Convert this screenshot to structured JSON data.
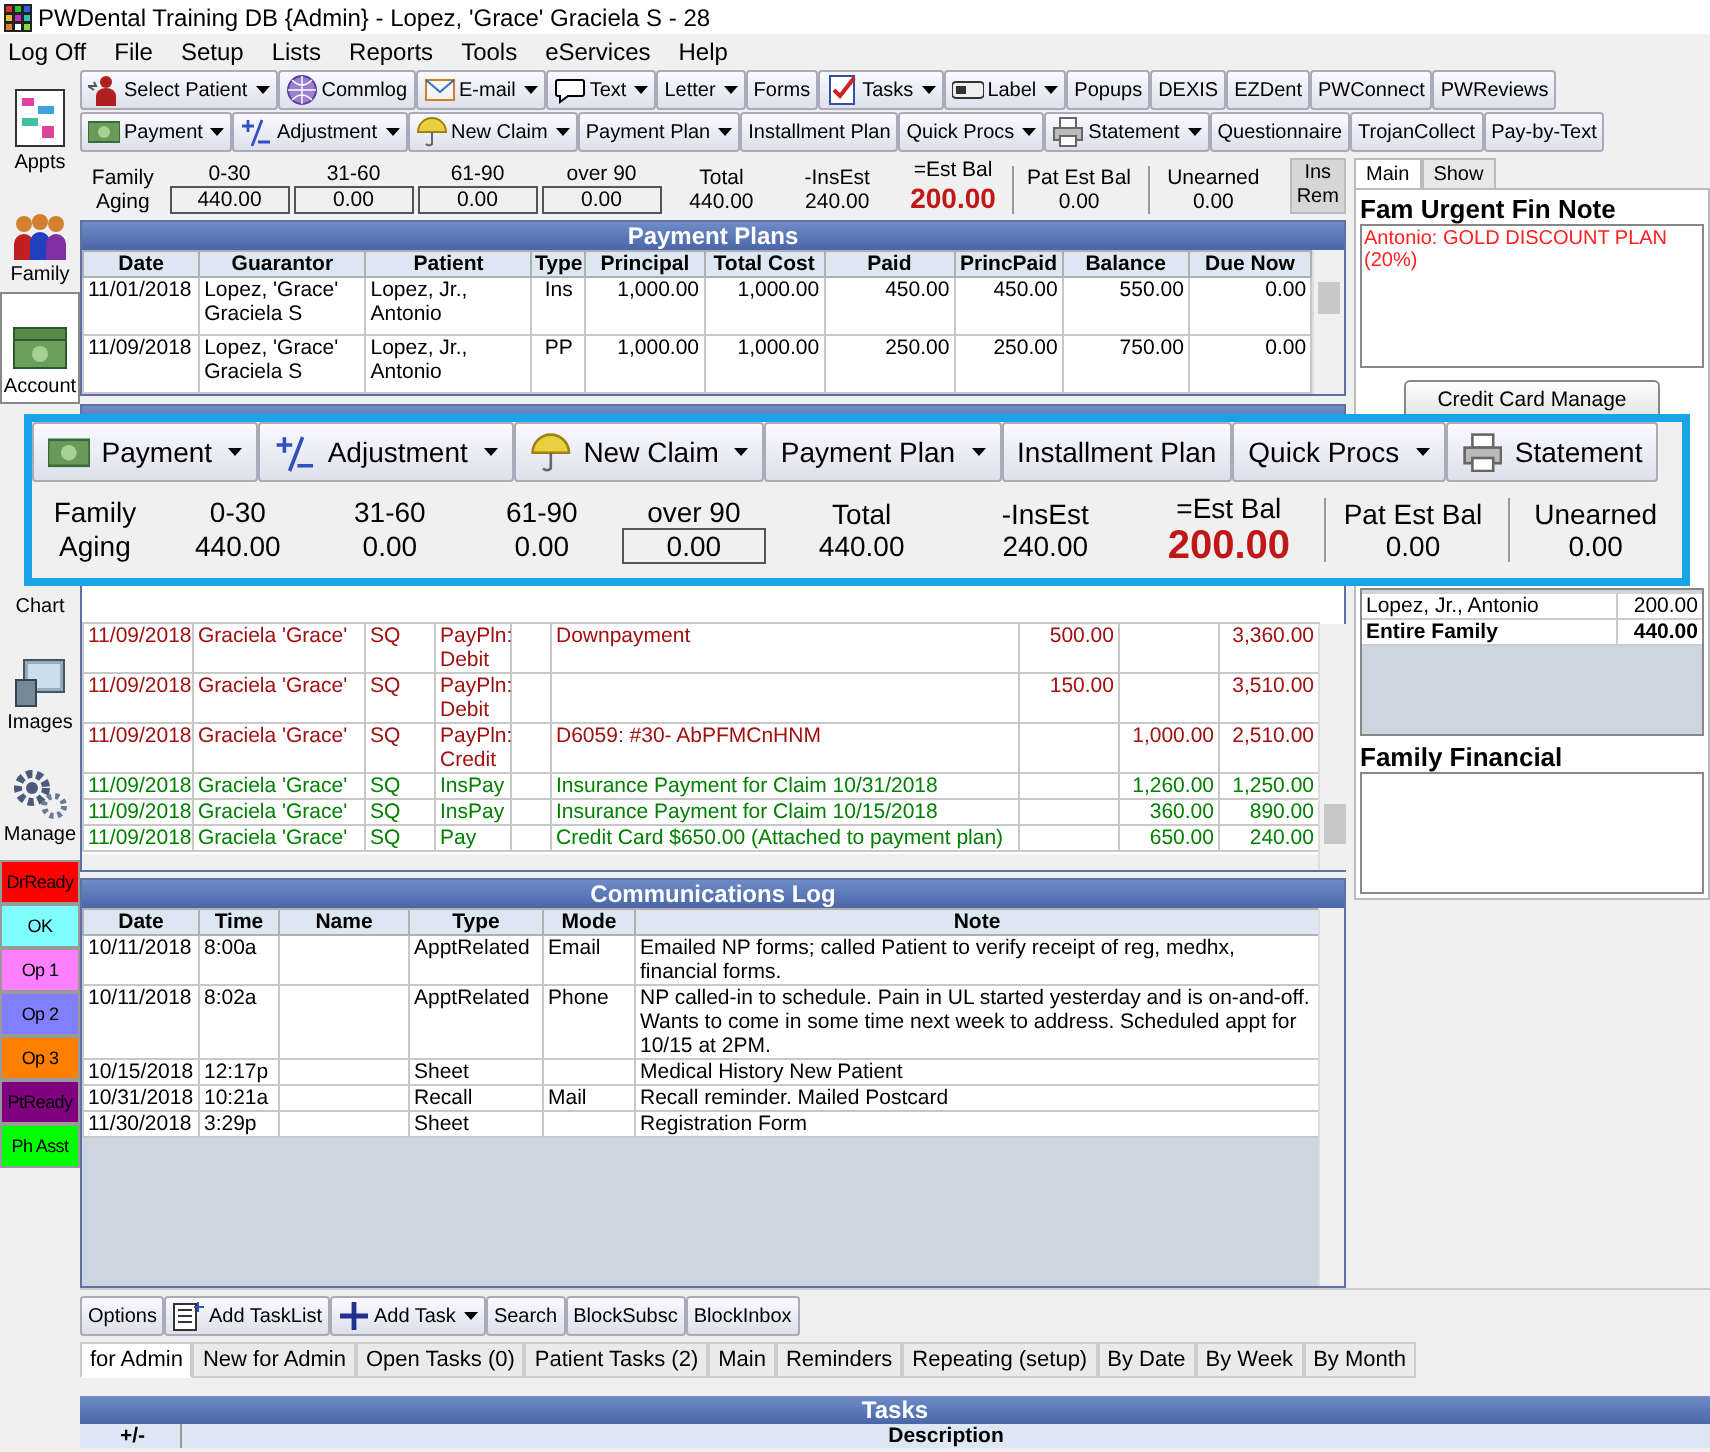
{
  "window": {
    "title": "PWDental Training DB {Admin} - Lopez, 'Grace' Graciela S - 28"
  },
  "menu": [
    "Log Off",
    "File",
    "Setup",
    "Lists",
    "Reports",
    "Tools",
    "eServices",
    "Help"
  ],
  "main_toolbar": [
    {
      "label": "Select Patient",
      "dropdown": true
    },
    {
      "label": "Commlog",
      "dropdown": false
    },
    {
      "label": "E-mail",
      "dropdown": true
    },
    {
      "label": "Text",
      "dropdown": true
    },
    {
      "label": "Letter",
      "dropdown": true
    },
    {
      "label": "Forms",
      "dropdown": false
    },
    {
      "label": "Tasks",
      "dropdown": true
    },
    {
      "label": "Label",
      "dropdown": true
    },
    {
      "label": "Popups",
      "dropdown": false
    },
    {
      "label": "DEXIS",
      "dropdown": false
    },
    {
      "label": "EZDent",
      "dropdown": false
    },
    {
      "label": "PWConnect",
      "dropdown": false
    },
    {
      "label": "PWReviews",
      "dropdown": false
    }
  ],
  "account_toolbar": [
    {
      "label": "Payment",
      "dropdown": true
    },
    {
      "label": "Adjustment",
      "dropdown": true
    },
    {
      "label": "New Claim",
      "dropdown": true
    },
    {
      "label": "Payment Plan",
      "dropdown": true
    },
    {
      "label": "Installment Plan",
      "dropdown": false
    },
    {
      "label": "Quick Procs",
      "dropdown": true
    },
    {
      "label": "Statement",
      "dropdown": true
    },
    {
      "label": "Questionnaire",
      "dropdown": false
    },
    {
      "label": "TrojanCollect",
      "dropdown": false
    },
    {
      "label": "Pay-by-Text",
      "dropdown": false
    }
  ],
  "aging": {
    "family_label": "Family Aging",
    "buckets": [
      {
        "label": "0-30",
        "value": "440.00",
        "boxed": true
      },
      {
        "label": "31-60",
        "value": "0.00",
        "boxed": true
      },
      {
        "label": "61-90",
        "value": "0.00",
        "boxed": true
      },
      {
        "label": "over 90",
        "value": "0.00",
        "boxed": true
      }
    ],
    "totals": [
      {
        "label": "Total",
        "value": "440.00",
        "kind": "plain"
      },
      {
        "label": "-InsEst",
        "value": "240.00",
        "kind": "plain"
      },
      {
        "label": "=Est Bal",
        "value": "200.00",
        "kind": "emphasis"
      }
    ],
    "balances": [
      {
        "label": "Pat Est Bal",
        "value": "0.00"
      },
      {
        "label": "Unearned",
        "value": "0.00"
      }
    ],
    "ins_rem_button": "Ins Rem"
  },
  "modules": [
    {
      "label": "Appts",
      "selected": false
    },
    {
      "label": "Family",
      "selected": false
    },
    {
      "label": "Account",
      "selected": true
    },
    {
      "label": "Chart",
      "selected": false
    },
    {
      "label": "Images",
      "selected": false
    },
    {
      "label": "Manage",
      "selected": false
    }
  ],
  "status_buttons": [
    {
      "label": "DrReady",
      "color": "#ff0000"
    },
    {
      "label": "OK",
      "color": "#80ffff"
    },
    {
      "label": "Op 1",
      "color": "#ff80ff"
    },
    {
      "label": "Op 2",
      "color": "#8080ff"
    },
    {
      "label": "Op 3",
      "color": "#ff8000"
    },
    {
      "label": "PtReady",
      "color": "#800080"
    },
    {
      "label": "Ph Asst",
      "color": "#00ff00"
    }
  ],
  "payment_plans": {
    "title": "Payment Plans",
    "columns": [
      "Date",
      "Guarantor",
      "Patient",
      "Type",
      "Principal",
      "Total Cost",
      "Paid",
      "PrincPaid",
      "Balance",
      "Due Now"
    ],
    "rows": [
      {
        "cells": [
          "11/01/2018",
          "Lopez, 'Grace' Graciela S",
          "Lopez, Jr., Antonio",
          "Ins",
          "1,000.00",
          "1,000.00",
          "450.00",
          "450.00",
          "550.00",
          "0.00"
        ]
      },
      {
        "cells": [
          "11/09/2018",
          "Lopez, 'Grace' Graciela S",
          "Lopez, Jr., Antonio",
          "PP",
          "1,000.00",
          "1,000.00",
          "250.00",
          "250.00",
          "750.00",
          "0.00"
        ]
      }
    ]
  },
  "ledger_rows": [
    {
      "color": "#a01010",
      "cells": [
        "11/09/2018",
        "Graciela 'Grace'",
        "SQ",
        "PayPln: Debit",
        "Downpayment",
        "500.00",
        null,
        "3,360.00"
      ]
    },
    {
      "color": "#a01010",
      "cells": [
        "11/09/2018",
        "Graciela 'Grace'",
        "SQ",
        "PayPln: Debit",
        null,
        "150.00",
        null,
        "3,510.00"
      ]
    },
    {
      "color": "#a01010",
      "cells": [
        "11/09/2018",
        "Graciela 'Grace'",
        "SQ",
        "PayPln: Credit",
        "D6059: #30- AbPFMCnHNM",
        null,
        "1,000.00",
        "2,510.00"
      ]
    },
    {
      "color": "#008000",
      "cells": [
        "11/09/2018",
        "Graciela 'Grace'",
        "SQ",
        "InsPay",
        "Insurance Payment for Claim 10/31/2018",
        null,
        "1,260.00",
        "1,250.00"
      ]
    },
    {
      "color": "#008000",
      "cells": [
        "11/09/2018",
        "Graciela 'Grace'",
        "SQ",
        "InsPay",
        "Insurance Payment for Claim 10/15/2018",
        null,
        "360.00",
        "890.00"
      ]
    },
    {
      "color": "#008000",
      "cells": [
        "11/09/2018",
        "Graciela 'Grace'",
        "SQ",
        "Pay",
        "Credit Card $650.00 (Attached to payment plan)",
        null,
        "650.00",
        "240.00"
      ]
    }
  ],
  "magnified": {
    "toolbar": [
      {
        "label": "Payment",
        "dropdown": true
      },
      {
        "label": "Adjustment",
        "dropdown": true
      },
      {
        "label": "New Claim",
        "dropdown": true
      },
      {
        "label": "Payment Plan",
        "dropdown": true
      },
      {
        "label": "Installment Plan",
        "dropdown": false
      },
      {
        "label": "Quick Procs",
        "dropdown": true
      },
      {
        "label": "Statement",
        "dropdown": false
      }
    ],
    "aging": {
      "family_label": "Family Aging",
      "buckets": [
        {
          "label": "0-30",
          "value": "440.00",
          "boxed": false
        },
        {
          "label": "31-60",
          "value": "0.00",
          "boxed": false
        },
        {
          "label": "61-90",
          "value": "0.00",
          "boxed": false
        },
        {
          "label": "over 90",
          "value": "0.00",
          "boxed": true
        }
      ],
      "totals": [
        {
          "label": "Total",
          "value": "440.00",
          "kind": "plain"
        },
        {
          "label": "-InsEst",
          "value": "240.00",
          "kind": "plain"
        },
        {
          "label": "=Est Bal",
          "value": "200.00",
          "kind": "emphasis"
        }
      ],
      "balances": [
        {
          "label": "Pat Est Bal",
          "value": "0.00"
        },
        {
          "label": "Unearned",
          "value": "0.00"
        }
      ]
    }
  },
  "right_panel": {
    "tabs": [
      {
        "label": "Main",
        "selected": true
      },
      {
        "label": "Show",
        "selected": false
      }
    ],
    "urgent_note_title": "Fam Urgent Fin Note",
    "urgent_note": "Antonio: GOLD DISCOUNT PLAN (20%)",
    "credit_card_button": "Credit Card Manage",
    "family_balances": [
      {
        "name": "Lopez, Jr., Antonio",
        "amount": "200.00",
        "total": false
      },
      {
        "name": "Entire Family",
        "amount": "440.00",
        "total": true
      }
    ],
    "family_financial_title": "Family Financial"
  },
  "comm_log": {
    "title": "Communications Log",
    "columns": [
      "Date",
      "Time",
      "Name",
      "Type",
      "Mode",
      "Note"
    ],
    "rows": [
      {
        "cells": [
          "10/11/2018",
          "8:00a",
          null,
          "ApptRelated",
          "Email",
          "Emailed NP forms; called Patient to verify receipt of reg, medhx, financial forms."
        ]
      },
      {
        "cells": [
          "10/11/2018",
          "8:02a",
          null,
          "ApptRelated",
          "Phone",
          "NP called-in to schedule. Pain in UL started yesterday and is on-and-off. Wants to come in some time next week to address.  Scheduled appt for 10/15 at 2PM."
        ]
      },
      {
        "cells": [
          "10/15/2018",
          "12:17p",
          null,
          "Sheet",
          null,
          "Medical History New Patient"
        ]
      },
      {
        "cells": [
          "10/31/2018",
          "10:21a",
          null,
          "Recall",
          "Mail",
          "Recall reminder.  Mailed Postcard"
        ]
      },
      {
        "cells": [
          "11/30/2018",
          "3:29p",
          null,
          "Sheet",
          null,
          "Registration Form"
        ]
      }
    ]
  },
  "task_toolbar": [
    {
      "label": "Options",
      "dropdown": false
    },
    {
      "label": "Add TaskList",
      "dropdown": false
    },
    {
      "label": "Add Task",
      "dropdown": true
    },
    {
      "label": "Search",
      "dropdown": false
    },
    {
      "label": "BlockSubsc",
      "dropdown": false
    },
    {
      "label": "BlockInbox",
      "dropdown": false
    }
  ],
  "task_tabs": [
    {
      "label": "for Admin",
      "selected": true
    },
    {
      "label": "New for Admin",
      "selected": false
    },
    {
      "label": "Open Tasks (0)",
      "selected": false
    },
    {
      "label": "Patient Tasks (2)",
      "selected": false
    },
    {
      "label": "Main",
      "selected": false
    },
    {
      "label": "Reminders",
      "selected": false
    },
    {
      "label": "Repeating (setup)",
      "selected": false
    },
    {
      "label": "By Date",
      "selected": false
    },
    {
      "label": "By Week",
      "selected": false
    },
    {
      "label": "By Month",
      "selected": false
    }
  ],
  "tasks": {
    "title": "Tasks",
    "columns": [
      "+/-",
      "Description"
    ]
  }
}
